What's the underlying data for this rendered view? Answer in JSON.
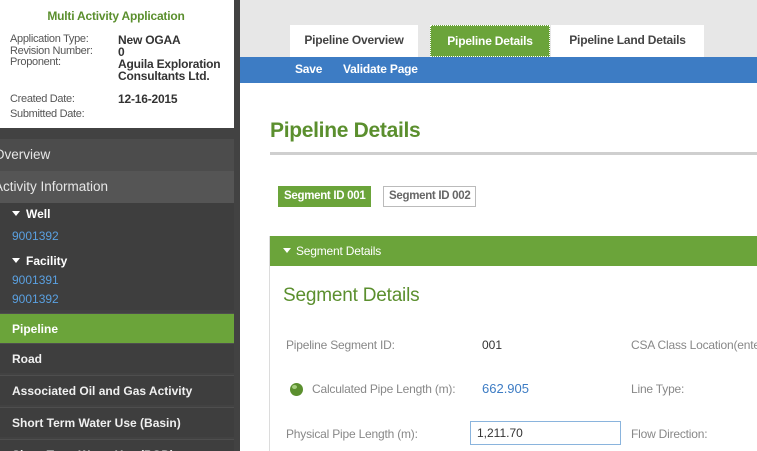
{
  "app_info": {
    "title": "Multi Activity Application",
    "application_type_label": "Application Type:",
    "application_type_value": "New OGAA",
    "revision_label": "Revision Number:",
    "revision_value": "0",
    "proponent_label": "Proponent:",
    "proponent_value_line1": "Aguila Exploration",
    "proponent_value_line2": "Consultants Ltd.",
    "created_label": "Created Date:",
    "created_value": "12-16-2015",
    "submitted_label": "Submitted Date:"
  },
  "sidebar": {
    "overview": "Overview",
    "activity_information": "Activity Information",
    "well": "Well",
    "well_items": [
      "9001392"
    ],
    "facility": "Facility",
    "facility_items": [
      "9001391",
      "9001392"
    ],
    "pipeline": "Pipeline",
    "road": "Road",
    "associated": "Associated Oil and Gas Activity",
    "short_term_basin": "Short Term Water Use (Basin)",
    "short_term_pod": "Short Term Water Use (POD)"
  },
  "tabs": {
    "overview": "Pipeline Overview",
    "details": "Pipeline Details",
    "land": "Pipeline Land Details"
  },
  "actions": {
    "save": "Save",
    "validate": "Validate Page"
  },
  "page": {
    "title": "Pipeline Details"
  },
  "segments": {
    "seg1": "Segment ID 001",
    "seg2": "Segment ID 002"
  },
  "segment_details": {
    "header": "Segment Details",
    "title": "Segment Details",
    "segment_id_label": "Pipeline Segment ID:",
    "segment_id_value": "001",
    "csa_label": "CSA Class Location(ente",
    "calc_length_label": "Calculated Pipe Length (m):",
    "calc_length_value": "662.905",
    "line_type_label": "Line Type:",
    "physical_length_label": "Physical Pipe Length (m):",
    "physical_length_value": "1,211.70",
    "flow_direction_label": "Flow Direction:"
  },
  "colors": {
    "green": "#6ba43a",
    "title_green": "#5b8f2e",
    "blue": "#3d7cc4",
    "sidebar": "#424242"
  }
}
